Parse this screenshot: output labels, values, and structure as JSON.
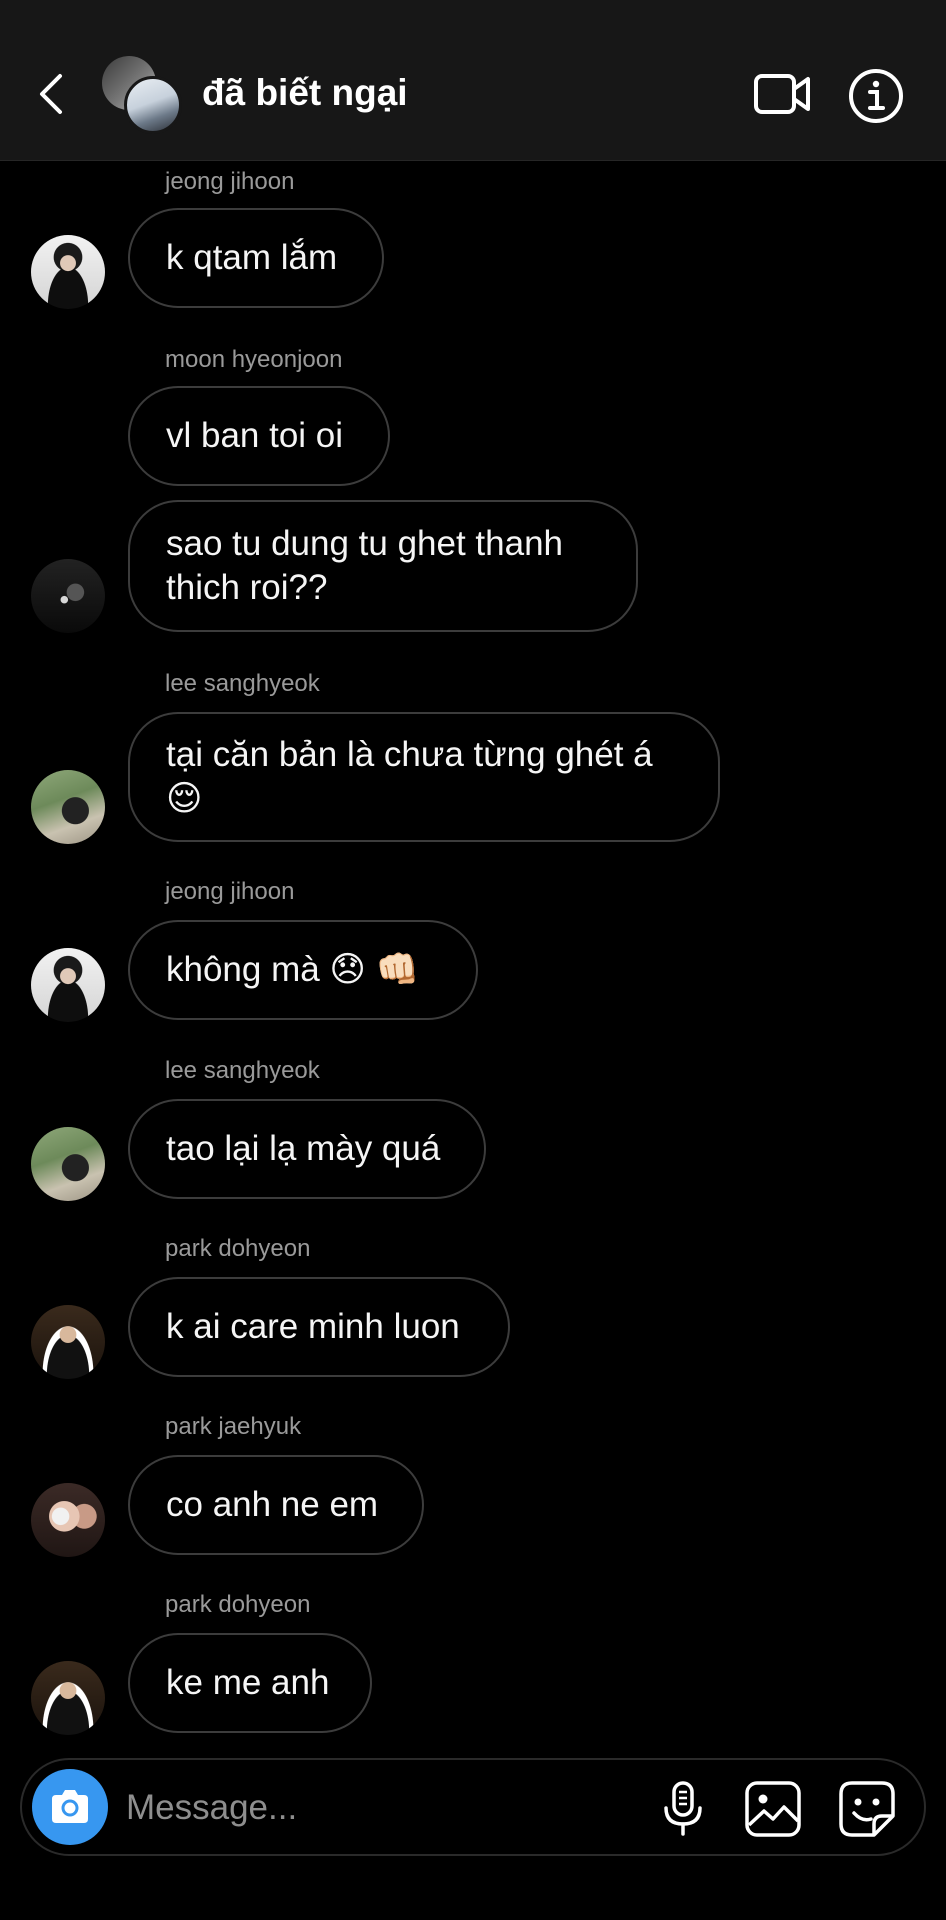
{
  "header": {
    "title": "đã biết ngại",
    "back_icon": "chevron-left-icon",
    "video_icon": "video-camera-icon",
    "info_icon": "info-icon"
  },
  "messages": [
    {
      "sender": "jeong jihoon",
      "text": "k qtam lắm"
    },
    {
      "sender": "moon hyeonjoon",
      "text": "vl ban toi oi"
    },
    {
      "sender": "",
      "text": "sao tu dung tu ghet thanh thich roi??"
    },
    {
      "sender": "lee sanghyeok",
      "text": "tại căn bản là chưa từng ghét á 😌"
    },
    {
      "sender": "jeong jihoon",
      "text": "không mà 😞 👊🏻"
    },
    {
      "sender": "lee sanghyeok",
      "text": "tao lại lạ mày quá"
    },
    {
      "sender": "park dohyeon",
      "text": "k ai care minh luon"
    },
    {
      "sender": "park jaehyuk",
      "text": "co anh ne em"
    },
    {
      "sender": "park dohyeon",
      "text": "ke me anh"
    }
  ],
  "composer": {
    "placeholder": "Message...",
    "camera_icon": "camera-icon",
    "mic_icon": "microphone-icon",
    "gallery_icon": "image-icon",
    "sticker_icon": "sticker-icon"
  },
  "colors": {
    "background": "#000000",
    "header_bg": "#171717",
    "bubble_border": "#3c3c3c",
    "sender_text": "#9a9a9a",
    "accent": "#3797f0"
  }
}
